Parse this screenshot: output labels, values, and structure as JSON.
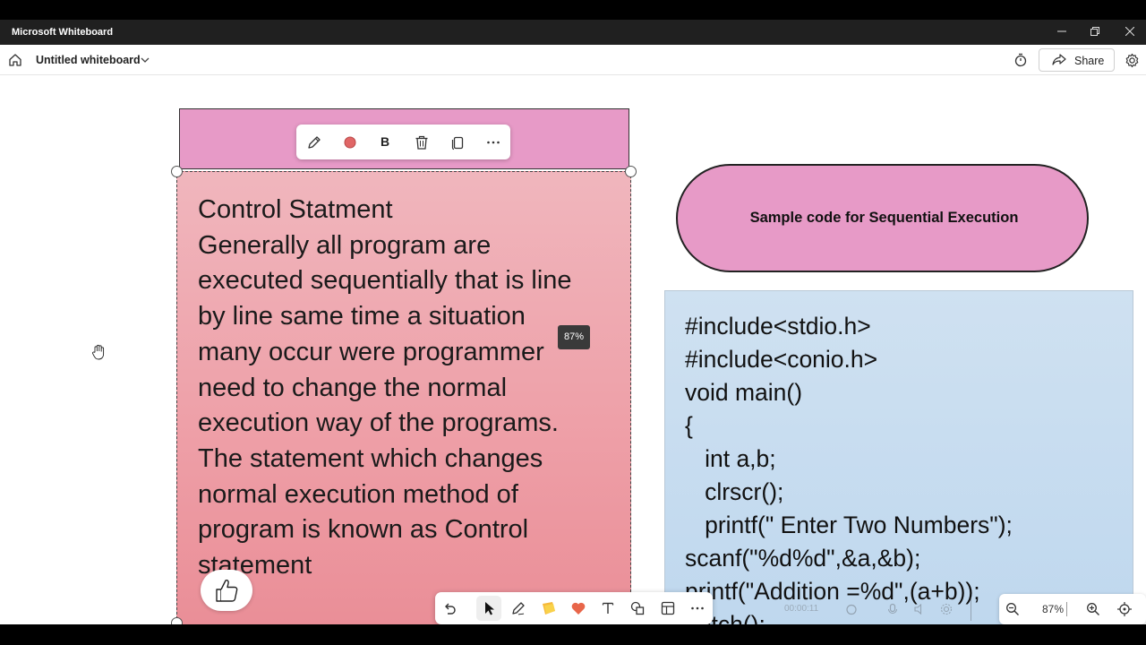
{
  "window": {
    "title": "Microsoft Whiteboard",
    "controls": [
      "minimize",
      "restore",
      "close"
    ]
  },
  "header": {
    "board_title": "Untitled whiteboard",
    "share_label": "Share"
  },
  "context_toolbar": {
    "items": [
      "pen-icon",
      "color-dot-icon",
      "bold",
      "delete-icon",
      "copy-icon",
      "more-icon"
    ],
    "bold_label": "B",
    "color": "#e06666"
  },
  "note": {
    "header_color": "#e79ac7",
    "title": "Control Statment",
    "body_lines": [
      "Generally all program are",
      "executed sequentially that is line",
      "by line same time a situation",
      "many occur were programmer",
      "need to change the normal",
      "execution way of the programs.",
      "The statement which changes",
      "normal execution method of",
      "program is known as Control",
      "statement"
    ],
    "zoom_badge": "87%"
  },
  "pill": {
    "text": "Sample code for Sequential Execution",
    "color": "#e79ac7"
  },
  "code": {
    "lines": [
      "#include<stdio.h>",
      "#include<conio.h>",
      "void main()",
      "{",
      "   int a,b;",
      "   clrscr();",
      "   printf(\" Enter Two Numbers\");",
      "scanf(\"%d%d\",&a,&b);",
      "printf(\"Addition =%d\",(a+b));",
      "getch();"
    ]
  },
  "bottom_toolbar": {
    "items": [
      "undo-icon",
      "select-icon",
      "pen-icon",
      "sticky-note-icon",
      "reaction-icon",
      "text-icon",
      "shapes-icon",
      "templates-icon",
      "more-icon"
    ]
  },
  "video_overlay": {
    "time": "00:00:11"
  },
  "zoom": {
    "level": "87%"
  }
}
